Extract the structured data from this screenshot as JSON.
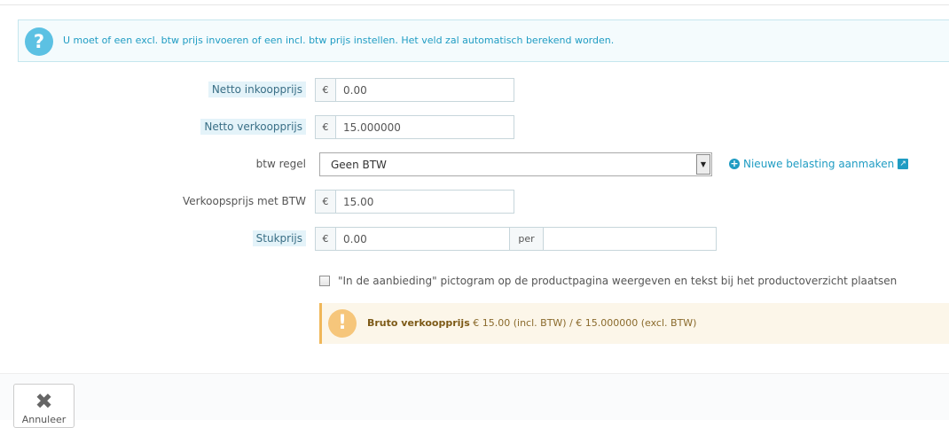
{
  "info_alert": {
    "icon": "question-icon",
    "icon_glyph": "?",
    "text": "U moet of een excl. btw prijs invoeren of een incl. btw prijs instellen. Het veld zal automatisch berekend worden."
  },
  "fields": {
    "netto_inkoopprijs": {
      "label": "Netto inkoopprijs",
      "currency": "€",
      "value": "0.00"
    },
    "netto_verkoopprijs": {
      "label": "Netto verkoopprijs",
      "currency": "€",
      "value": "15.000000"
    },
    "btw_regel": {
      "label": "btw regel",
      "selected": "Geen BTW"
    },
    "verkoopsprijs_met_btw": {
      "label": "Verkoopsprijs met BTW",
      "currency": "€",
      "value": "15.00"
    },
    "stukprijs": {
      "label": "Stukprijs",
      "currency": "€",
      "value": "0.00",
      "per_label": "per",
      "per_value": ""
    }
  },
  "new_tax_link": {
    "label": "Nieuwe belasting aanmaken"
  },
  "on_sale": {
    "label": "\"In de aanbieding\" pictogram op de productpagina weergeven en tekst bij het productoverzicht plaatsen",
    "checked": false
  },
  "summary": {
    "icon_glyph": "!",
    "title": "Bruto verkoopprijs",
    "text": " € 15.00 (incl. BTW) / € 15.000000 (excl. BTW)"
  },
  "footer": {
    "cancel_label": "Annuleer"
  },
  "colors": {
    "accent": "#1f9cc3",
    "info_bg": "#f4fbfd",
    "warning_bg": "#fcf6e9",
    "warning_icon": "#f6c67b"
  }
}
